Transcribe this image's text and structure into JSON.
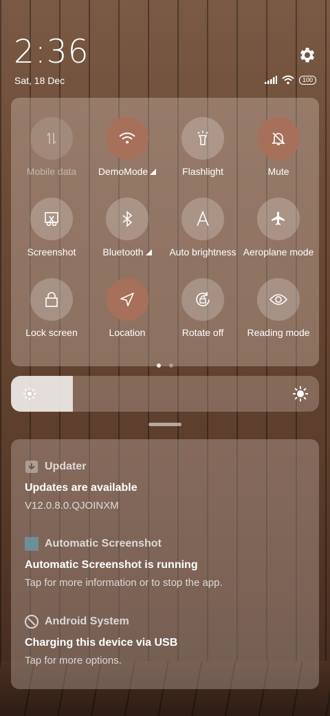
{
  "status": {
    "time": "2:36",
    "date": "Sat, 18 Dec",
    "battery": "100",
    "icons": [
      "signal-icon",
      "wifi-icon",
      "battery-icon",
      "gear-icon"
    ]
  },
  "quick_settings": {
    "tiles": [
      {
        "label": "Mobile data",
        "icon": "mobile-data-icon",
        "state": "disabled"
      },
      {
        "label": "DemoMode",
        "icon": "wifi-icon",
        "state": "on"
      },
      {
        "label": "Flashlight",
        "icon": "flashlight-icon",
        "state": "off"
      },
      {
        "label": "Mute",
        "icon": "bell-off-icon",
        "state": "on"
      },
      {
        "label": "Screenshot",
        "icon": "scissors-icon",
        "state": "off"
      },
      {
        "label": "Bluetooth",
        "icon": "bluetooth-icon",
        "state": "off"
      },
      {
        "label": "Auto brightness",
        "icon": "letter-a-icon",
        "state": "off"
      },
      {
        "label": "Aeroplane mode",
        "icon": "airplane-icon",
        "state": "off"
      },
      {
        "label": "Lock screen",
        "icon": "lock-icon",
        "state": "off"
      },
      {
        "label": "Location",
        "icon": "location-arrow-icon",
        "state": "on"
      },
      {
        "label": "Rotate off",
        "icon": "rotate-lock-icon",
        "state": "off"
      },
      {
        "label": "Reading mode",
        "icon": "eye-icon",
        "state": "off"
      }
    ],
    "page_count": 2,
    "current_page": 1
  },
  "brightness": {
    "level": 0.2
  },
  "notifications": [
    {
      "app": "Updater",
      "title": "Updates are available",
      "text": "V12.0.8.0.QJOINXM",
      "icon": "updater-icon"
    },
    {
      "app": "Automatic Screenshot",
      "title": "Automatic Screenshot is running",
      "text": "Tap for more information or to stop the app.",
      "icon": "square-app-icon"
    },
    {
      "app": "Android System",
      "title": "Charging this device via USB",
      "text": "Tap for more options.",
      "icon": "android-system-icon"
    }
  ],
  "colors": {
    "accent_on": "#a7705a"
  }
}
